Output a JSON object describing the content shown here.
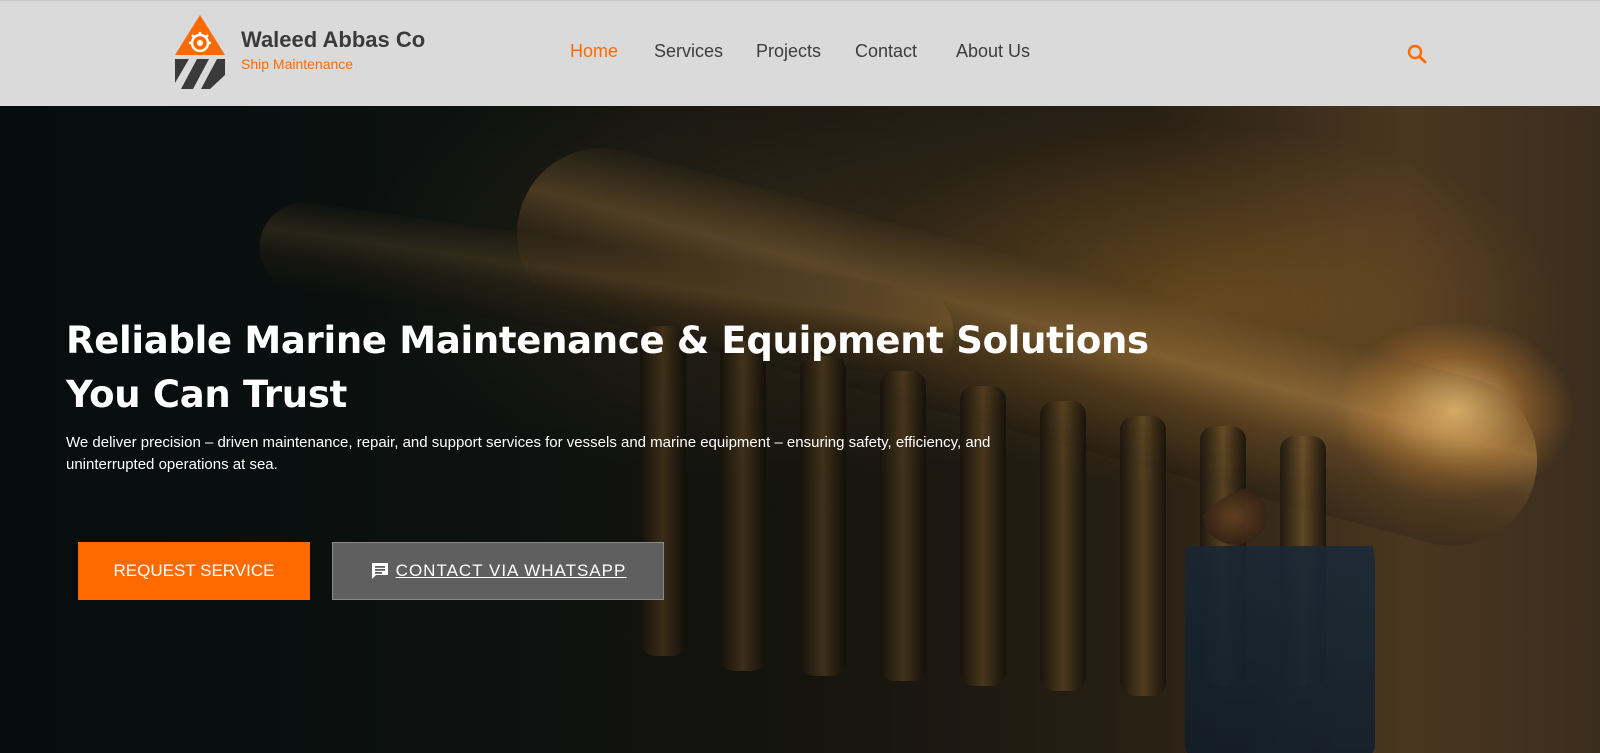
{
  "brand": {
    "name": "Waleed Abbas Co",
    "tagline": "Ship Maintenance"
  },
  "nav": {
    "items": [
      {
        "label": "Home",
        "active": true
      },
      {
        "label": "Services",
        "active": false
      },
      {
        "label": "Projects",
        "active": false
      },
      {
        "label": "Contact",
        "active": false
      },
      {
        "label": "About Us",
        "active": false
      }
    ]
  },
  "hero": {
    "headline_line1": "Reliable Marine Maintenance & Equipment Solutions",
    "headline_line2": "You Can Trust",
    "description": "We deliver precision – driven maintenance, repair, and support services for vessels and marine equipment – ensuring safety, efficiency, and uninterrupted operations at sea.",
    "primary_button": "REQUEST SERVICE",
    "secondary_button": "CONTACT VIA WHATSAPP"
  },
  "icons": {
    "search": "search-icon",
    "chat": "chat-icon",
    "logo": "logo-gear-triangle"
  },
  "colors": {
    "accent": "#ff6a00",
    "header_bg": "#dadada",
    "nav_text": "#3c3c3c",
    "secondary_button_bg": "#5f5f5f"
  }
}
